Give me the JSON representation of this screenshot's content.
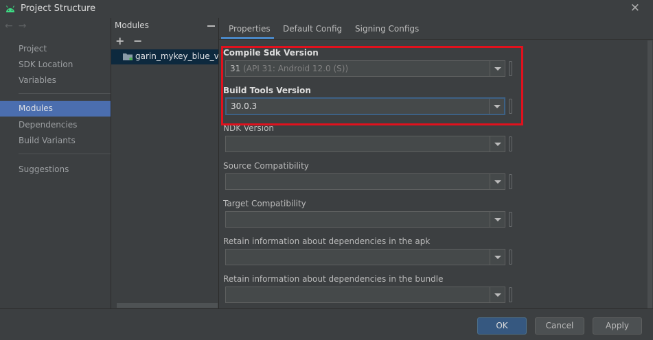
{
  "window": {
    "title": "Project Structure",
    "app_icon": "android-icon",
    "close_icon": "close-icon"
  },
  "nav": {
    "back_icon": "back-arrow-icon",
    "forward_icon": "forward-arrow-icon"
  },
  "sidebar": {
    "items": [
      {
        "label": "Project"
      },
      {
        "label": "SDK Location"
      },
      {
        "label": "Variables"
      },
      {
        "label": "Modules",
        "selected": true
      },
      {
        "label": "Dependencies"
      },
      {
        "label": "Build Variants"
      },
      {
        "label": "Suggestions"
      }
    ]
  },
  "modules_panel": {
    "header": "Modules",
    "add_icon": "plus-icon",
    "remove_icon": "minus-icon",
    "items": [
      {
        "name": "garin_mykey_blue_van",
        "icon": "module-folder-icon"
      }
    ]
  },
  "tabs": [
    {
      "label": "Properties",
      "active": true
    },
    {
      "label": "Default Config"
    },
    {
      "label": "Signing Configs"
    }
  ],
  "properties": {
    "compile_sdk": {
      "label": "Compile Sdk Version",
      "value": "31",
      "hint": "(API 31: Android 12.0 (S))"
    },
    "build_tools": {
      "label": "Build Tools Version",
      "value": "30.0.3"
    },
    "ndk": {
      "label": "NDK Version",
      "value": ""
    },
    "source_compat": {
      "label": "Source Compatibility",
      "value": ""
    },
    "target_compat": {
      "label": "Target Compatibility",
      "value": ""
    },
    "retain_apk": {
      "label": "Retain information about dependencies in the apk",
      "value": ""
    },
    "retain_bundle": {
      "label": "Retain information about dependencies in the bundle",
      "value": ""
    }
  },
  "footer": {
    "ok": "OK",
    "cancel": "Cancel",
    "apply": "Apply"
  },
  "colors": {
    "accent": "#4b6eaf",
    "highlight": "#e1111d",
    "primary_button": "#365880"
  }
}
